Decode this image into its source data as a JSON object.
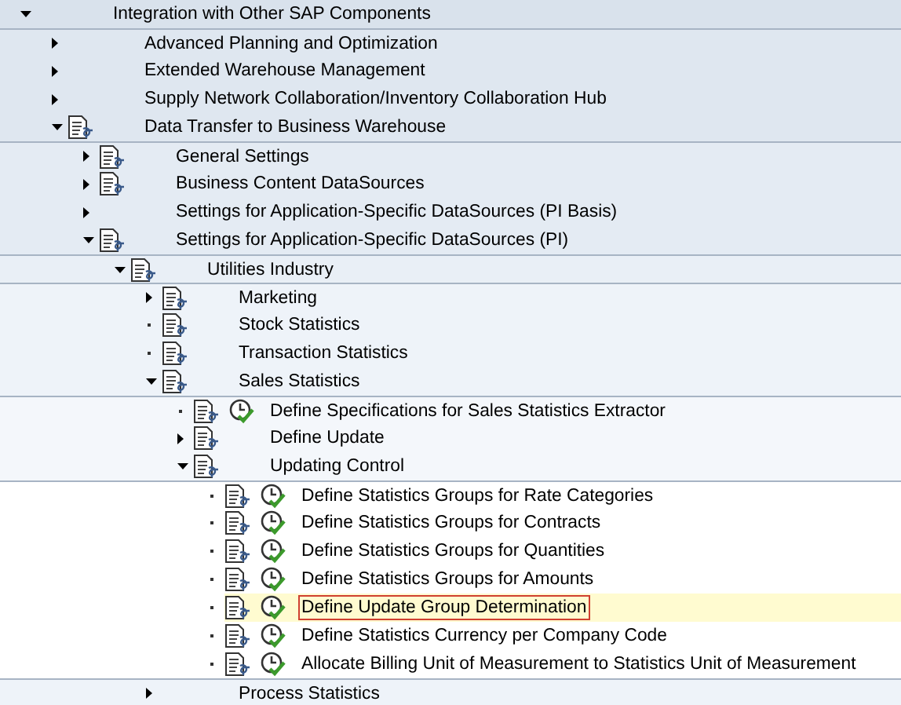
{
  "tree": [
    {
      "label": "Integration with Other SAP Components",
      "kind": "folder",
      "expanded": true,
      "doc": false,
      "activity": false,
      "selected": false,
      "children": [
        {
          "label": "Advanced Planning and Optimization",
          "kind": "folder",
          "expanded": false,
          "doc": false,
          "activity": false,
          "selected": false
        },
        {
          "label": "Extended Warehouse Management",
          "kind": "folder",
          "expanded": false,
          "doc": false,
          "activity": false,
          "selected": false
        },
        {
          "label": "Supply Network Collaboration/Inventory Collaboration Hub",
          "kind": "folder",
          "expanded": false,
          "doc": false,
          "activity": false,
          "selected": false
        },
        {
          "label": "Data Transfer to Business Warehouse",
          "kind": "folder",
          "expanded": true,
          "doc": true,
          "activity": false,
          "selected": false,
          "children": [
            {
              "label": "General Settings",
              "kind": "folder",
              "expanded": false,
              "doc": true,
              "activity": false,
              "selected": false
            },
            {
              "label": "Business Content DataSources",
              "kind": "folder",
              "expanded": false,
              "doc": true,
              "activity": false,
              "selected": false
            },
            {
              "label": "Settings for Application-Specific DataSources (PI Basis)",
              "kind": "folder",
              "expanded": false,
              "doc": false,
              "activity": false,
              "selected": false
            },
            {
              "label": "Settings for Application-Specific DataSources (PI)",
              "kind": "folder",
              "expanded": true,
              "doc": true,
              "activity": false,
              "selected": false,
              "children": [
                {
                  "label": "Utilities Industry",
                  "kind": "folder",
                  "expanded": true,
                  "doc": true,
                  "activity": false,
                  "selected": false,
                  "children": [
                    {
                      "label": "Marketing",
                      "kind": "folder",
                      "expanded": false,
                      "doc": true,
                      "activity": false,
                      "selected": false
                    },
                    {
                      "label": "Stock Statistics",
                      "kind": "leaf",
                      "doc": true,
                      "activity": false,
                      "selected": false
                    },
                    {
                      "label": "Transaction Statistics",
                      "kind": "leaf",
                      "doc": true,
                      "activity": false,
                      "selected": false
                    },
                    {
                      "label": "Sales Statistics",
                      "kind": "folder",
                      "expanded": true,
                      "doc": true,
                      "activity": false,
                      "selected": false,
                      "children": [
                        {
                          "label": "Define Specifications for Sales Statistics Extractor",
                          "kind": "leaf",
                          "doc": true,
                          "activity": true,
                          "selected": false
                        },
                        {
                          "label": "Define Update",
                          "kind": "folder",
                          "expanded": false,
                          "doc": true,
                          "activity": false,
                          "selected": false
                        },
                        {
                          "label": "Updating Control",
                          "kind": "folder",
                          "expanded": true,
                          "doc": true,
                          "activity": false,
                          "selected": false,
                          "children": [
                            {
                              "label": "Define Statistics Groups for Rate Categories",
                              "kind": "leaf",
                              "doc": true,
                              "activity": true,
                              "selected": false
                            },
                            {
                              "label": "Define Statistics Groups for Contracts",
                              "kind": "leaf",
                              "doc": true,
                              "activity": true,
                              "selected": false
                            },
                            {
                              "label": "Define Statistics Groups for Quantities",
                              "kind": "leaf",
                              "doc": true,
                              "activity": true,
                              "selected": false
                            },
                            {
                              "label": "Define Statistics Groups for Amounts",
                              "kind": "leaf",
                              "doc": true,
                              "activity": true,
                              "selected": false
                            },
                            {
                              "label": "Define Update Group Determination",
                              "kind": "leaf",
                              "doc": true,
                              "activity": true,
                              "selected": true
                            },
                            {
                              "label": "Define Statistics Currency per Company Code",
                              "kind": "leaf",
                              "doc": true,
                              "activity": true,
                              "selected": false
                            },
                            {
                              "label": "Allocate Billing Unit of Measurement to Statistics Unit of Measurement",
                              "kind": "leaf",
                              "doc": true,
                              "activity": true,
                              "selected": false
                            }
                          ]
                        }
                      ]
                    },
                    {
                      "label": "Process Statistics",
                      "kind": "folder",
                      "expanded": false,
                      "doc": false,
                      "activity": false,
                      "selected": false
                    }
                  ]
                }
              ]
            }
          ]
        }
      ]
    }
  ]
}
